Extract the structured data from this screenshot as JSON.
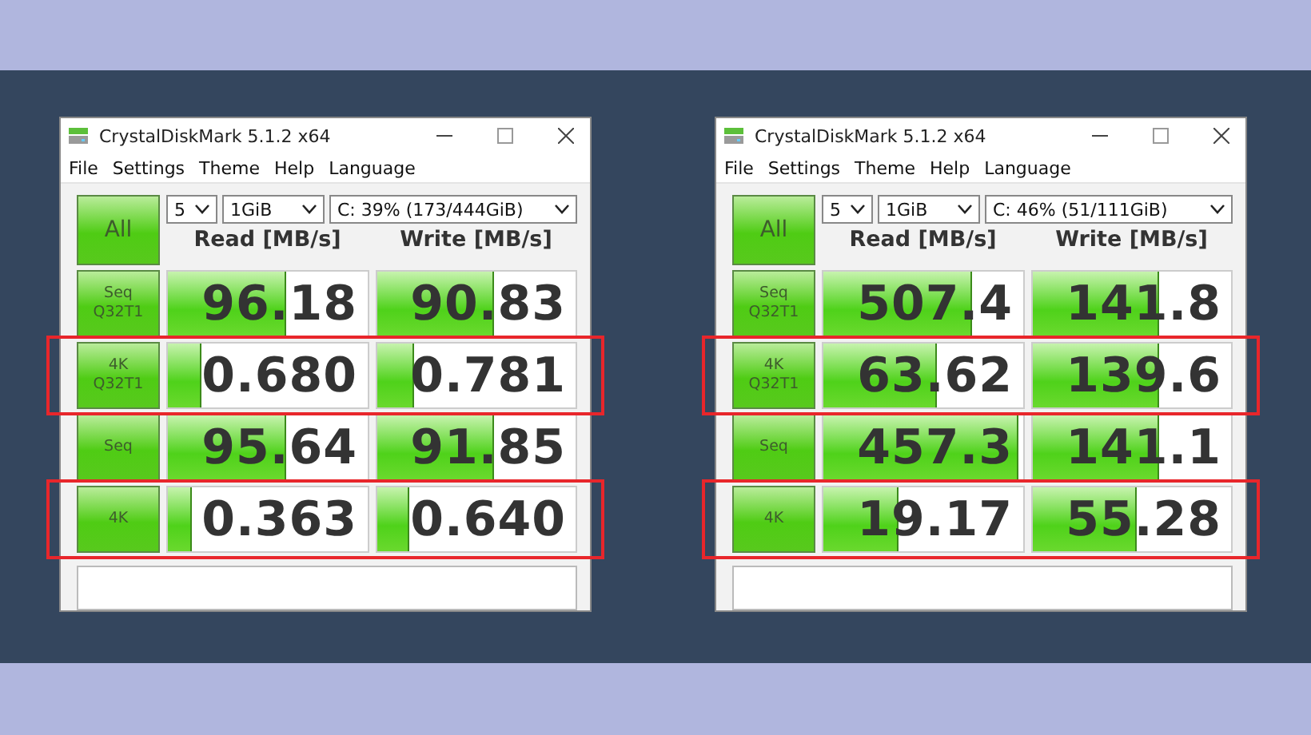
{
  "windows": [
    {
      "title": "CrystalDiskMark 5.1.2 x64",
      "menu": [
        "File",
        "Settings",
        "Theme",
        "Help",
        "Language"
      ],
      "count": "5",
      "size": "1GiB",
      "drive": "C: 39% (173/444GiB)",
      "all_button": "All",
      "headers": [
        "Read [MB/s]",
        "Write [MB/s]"
      ],
      "rows": [
        {
          "label": "Seq Q32T1",
          "highlighted": false,
          "read": {
            "value": "96.18",
            "level": 0.59
          },
          "write": {
            "value": "90.83",
            "level": 0.58
          }
        },
        {
          "label": "4K Q32T1",
          "highlighted": true,
          "read": {
            "value": "0.680",
            "level": 0.16
          },
          "write": {
            "value": "0.781",
            "level": 0.18
          }
        },
        {
          "label": "Seq",
          "highlighted": false,
          "read": {
            "value": "95.64",
            "level": 0.59
          },
          "write": {
            "value": "91.85",
            "level": 0.58
          }
        },
        {
          "label": "4K",
          "highlighted": true,
          "read": {
            "value": "0.363",
            "level": 0.11
          },
          "write": {
            "value": "0.640",
            "level": 0.16
          }
        }
      ]
    },
    {
      "title": "CrystalDiskMark 5.1.2 x64",
      "menu": [
        "File",
        "Settings",
        "Theme",
        "Help",
        "Language"
      ],
      "count": "5",
      "size": "1GiB",
      "drive": "C: 46% (51/111GiB)",
      "all_button": "All",
      "headers": [
        "Read [MB/s]",
        "Write [MB/s]"
      ],
      "rows": [
        {
          "label": "Seq Q32T1",
          "highlighted": false,
          "read": {
            "value": "507.4",
            "level": 0.74
          },
          "write": {
            "value": "141.8",
            "level": 0.63
          }
        },
        {
          "label": "4K Q32T1",
          "highlighted": true,
          "read": {
            "value": "63.62",
            "level": 0.56
          },
          "write": {
            "value": "139.6",
            "level": 0.63
          }
        },
        {
          "label": "Seq",
          "highlighted": false,
          "read": {
            "value": "457.3",
            "level": 0.97
          },
          "write": {
            "value": "141.1",
            "level": 0.63
          }
        },
        {
          "label": "4K",
          "highlighted": true,
          "read": {
            "value": "19.17",
            "level": 0.37
          },
          "write": {
            "value": "55.28",
            "level": 0.52
          }
        }
      ]
    }
  ]
}
